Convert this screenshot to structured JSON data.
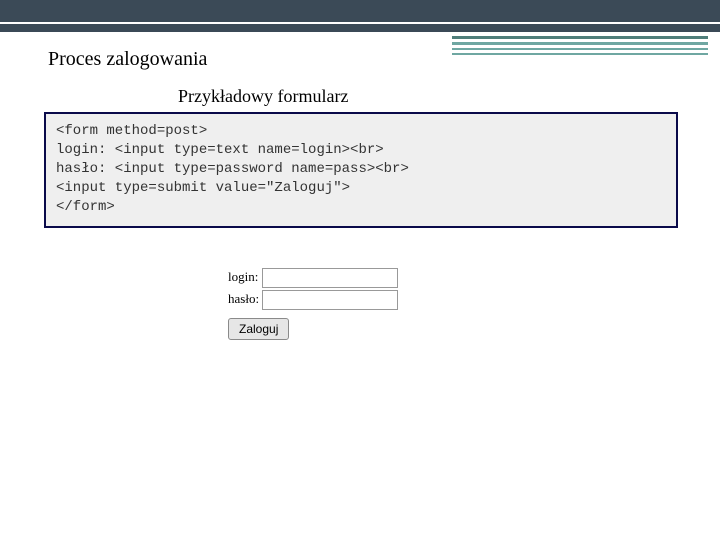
{
  "header": {
    "title": "Proces zalogowania",
    "subtitle": "Przykładowy formularz"
  },
  "code": {
    "content": "<form method=post>\nlogin: <input type=text name=login><br>\nhasło: <input type=password name=pass><br>\n<input type=submit value=\"Zaloguj\">\n</form>"
  },
  "form": {
    "login_label": "login:",
    "login_value": "",
    "password_label": "hasło:",
    "password_value": "",
    "submit_label": "Zaloguj"
  }
}
